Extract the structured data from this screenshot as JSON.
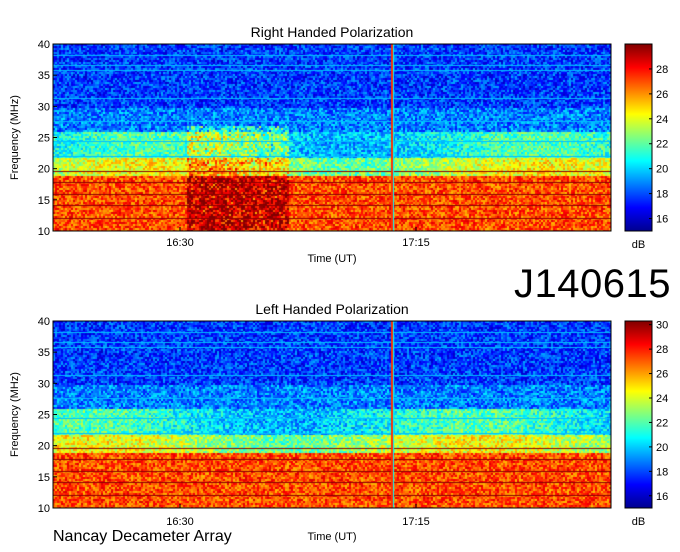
{
  "figure": {
    "id_label": "J140615",
    "observatory": "Nancay Decameter Array"
  },
  "chart_data": [
    {
      "type": "heatmap",
      "title": "Right Handed Polarization",
      "xlabel": "Time (UT)",
      "ylabel": "Frequency (MHz)",
      "x_ticks": [
        "16:30",
        "17:15"
      ],
      "y_ticks": [
        10,
        15,
        20,
        25,
        30,
        35,
        40
      ],
      "ylim": [
        10,
        40
      ],
      "colorbar": {
        "label": "dB",
        "ticks": [
          16,
          18,
          20,
          22,
          24,
          26,
          28
        ],
        "range": [
          15,
          30
        ]
      },
      "colormap": [
        "#00008f",
        "#0000ff",
        "#0080ff",
        "#00ffff",
        "#80ff80",
        "#ffff00",
        "#ff8000",
        "#ff0000",
        "#800000"
      ]
    },
    {
      "type": "heatmap",
      "title": "Left Handed Polarization",
      "xlabel": "Time (UT)",
      "ylabel": "Frequency (MHz)",
      "x_ticks": [
        "16:30",
        "17:15"
      ],
      "y_ticks": [
        10,
        15,
        20,
        25,
        30,
        35,
        40
      ],
      "ylim": [
        10,
        40
      ],
      "colorbar": {
        "label": "dB",
        "ticks": [
          16,
          18,
          20,
          22,
          24,
          26,
          28,
          30
        ],
        "range": [
          15,
          30.3
        ]
      },
      "colormap": [
        "#00008f",
        "#0000ff",
        "#0080ff",
        "#00ffff",
        "#80ff80",
        "#ffff00",
        "#ff8000",
        "#ff0000",
        "#800000"
      ]
    }
  ]
}
